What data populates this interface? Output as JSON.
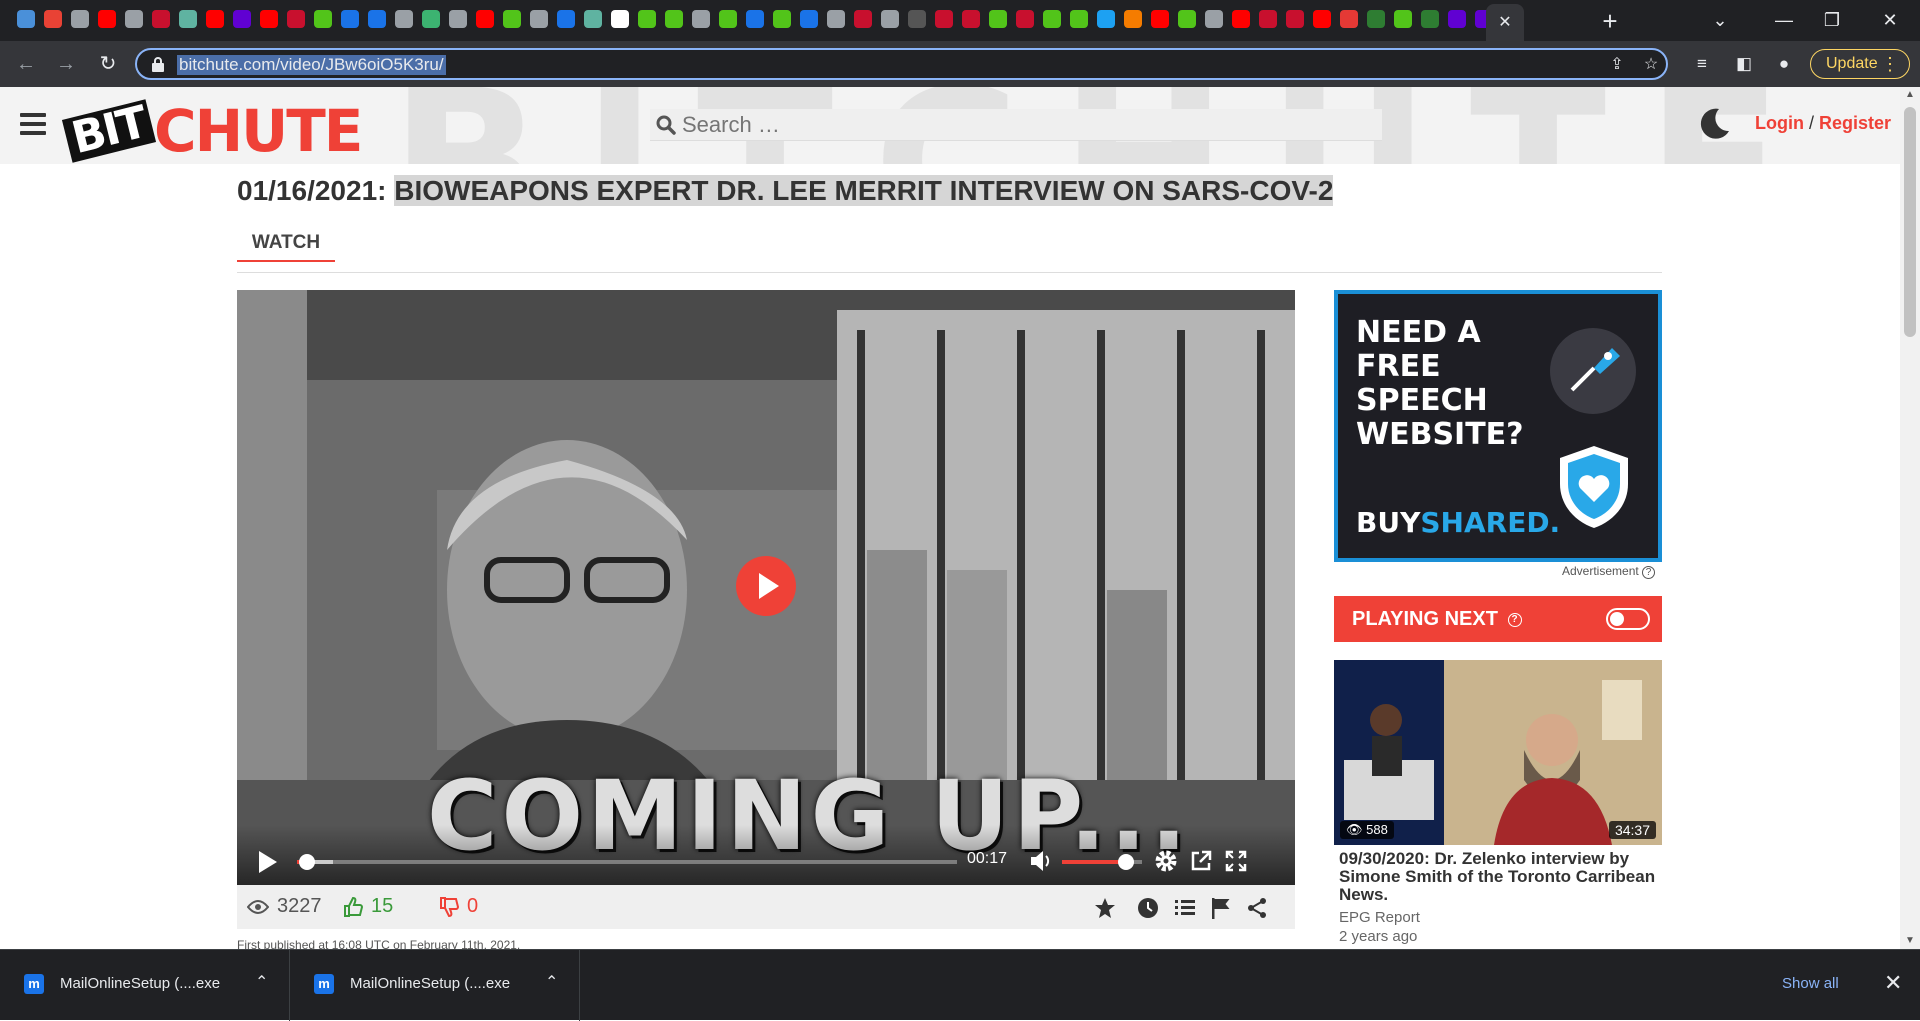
{
  "browser": {
    "tab_favicon_colors": [
      "#4a90d9",
      "#e94235",
      "#9aa0a6",
      "#ff0000",
      "#9aa0a6",
      "#c8102e",
      "#5fb3a1",
      "#ff0000",
      "#6001d2",
      "#ff0000",
      "#c8102e",
      "#52c41a",
      "#1a73e8",
      "#1a73e8",
      "#9aa0a6",
      "#3cb371",
      "#9aa0a6",
      "#ff0000",
      "#52c41a",
      "#9aa0a6",
      "#1a73e8",
      "#5fb3a1",
      "#ffffff",
      "#52c41a",
      "#52c41a",
      "#9aa0a6",
      "#52c41a",
      "#1a73e8",
      "#52c41a",
      "#1a73e8",
      "#9aa0a6",
      "#c8102e",
      "#9aa0a6",
      "#555555",
      "#c8102e",
      "#c8102e",
      "#52c41a",
      "#c8102e",
      "#52c41a",
      "#52c41a",
      "#1da1f2",
      "#f57c00",
      "#ff0000",
      "#52c41a",
      "#9aa0a6",
      "#ff0000",
      "#c8102e",
      "#c8102e",
      "#ff0000",
      "#e53935",
      "#2e7d32",
      "#52c41a",
      "#2e7d32",
      "#6001d2",
      "#6001d2",
      "#6001d2"
    ],
    "active_tab_close": "✕",
    "new_tab": "+",
    "url": "bitchute.com/video/JBw6oiO5K3ru/",
    "update_label": "Update"
  },
  "site": {
    "logo_bit": "BIT",
    "logo_chute": "CHUTE",
    "search_placeholder": "Search …",
    "login": "Login",
    "separator": "/",
    "register": "Register"
  },
  "video": {
    "date_prefix": "01/16/2021:",
    "title": "BIOWEAPONS EXPERT DR. LEE MERRIT INTERVIEW ON SARS-COV-2",
    "tab_watch": "WATCH",
    "caption_text": "COMING UP...",
    "time": "00:17",
    "progress_fraction": 0.015,
    "buffer_fraction": 0.055,
    "volume_fraction": 0.8,
    "views": "3227",
    "likes": "15",
    "dislikes": "0",
    "published": "First published at 16:08 UTC on February 11th, 2021."
  },
  "ad": {
    "text": "NEED A FREE SPEECH WEBSITE?",
    "brand_a": "BUY",
    "brand_b": "SHARED.",
    "label": "Advertisement",
    "label_q": "?"
  },
  "playing_next": {
    "label": "PLAYING NEXT",
    "help": "?",
    "views": "588",
    "duration": "34:37",
    "title": "09/30/2020: Dr. Zelenko interview by Simone Smith of the Toronto Carribean News.",
    "channel": "EPG Report",
    "age": "2 years ago"
  },
  "downloads": {
    "items": [
      {
        "name": "MailOnlineSetup (....exe"
      },
      {
        "name": "MailOnlineSetup (....exe"
      }
    ],
    "show_all": "Show all",
    "close": "✕"
  }
}
